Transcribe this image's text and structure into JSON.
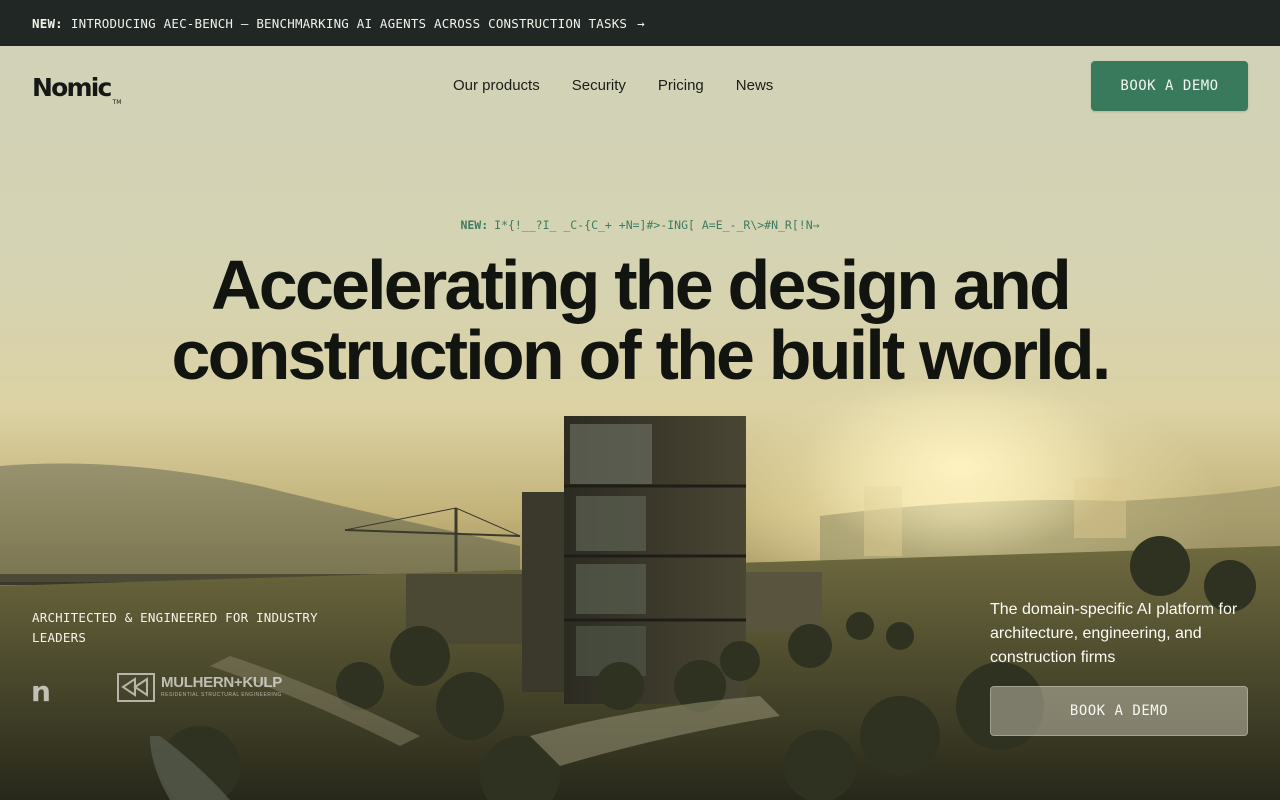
{
  "announcement": {
    "prefix": "NEW:",
    "text": "INTRODUCING AEC-BENCH — BENCHMARKING AI AGENTS ACROSS CONSTRUCTION TASKS",
    "arrow": "→"
  },
  "nav": {
    "logo": "Nomic",
    "logo_mark": "TM",
    "links": [
      "Our products",
      "Security",
      "Pricing",
      "News"
    ],
    "cta": "BOOK A DEMO"
  },
  "hero": {
    "kicker_prefix": "NEW:",
    "kicker_text": "I*{!__?I_ _C-{C_+ +N=]#>-ING[ A=E_-_R\\>#N_R[!N→",
    "headline_line1": "Accelerating the design and",
    "headline_line2": "construction of the built world.",
    "leaders_label": "ARCHITECTED & ENGINEERED FOR INDUSTRY LEADERS",
    "clients": {
      "first_logo": "n",
      "second_logo_name": "MULHERN+KULP",
      "second_logo_sub": "RESIDENTIAL STRUCTURAL ENGINEERING"
    },
    "tagline": "The domain-specific AI platform for architecture, engineering, and construction firms",
    "cta": "BOOK A DEMO"
  },
  "colors": {
    "announcement_bg": "#212724",
    "accent_green": "#3a7a5c",
    "headline": "#121410"
  }
}
